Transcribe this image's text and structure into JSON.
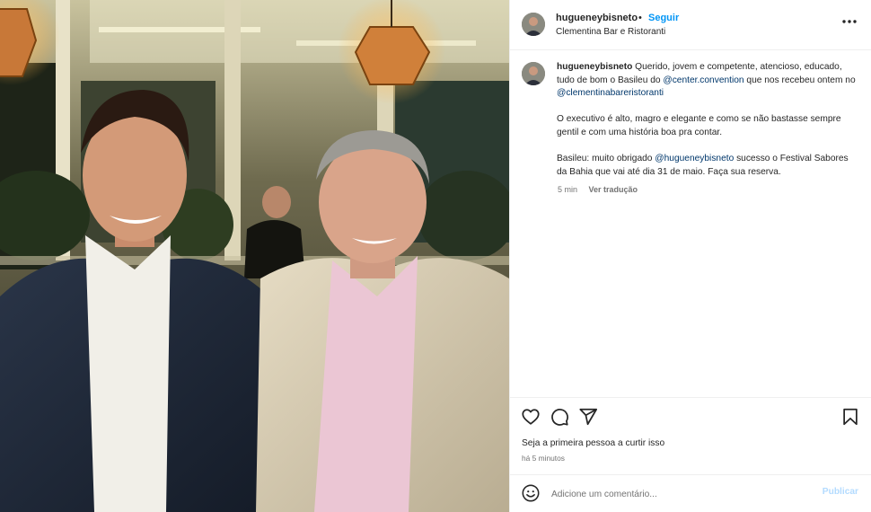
{
  "post": {
    "username": "hugueneybisneto",
    "dot": "•",
    "follow_label": "Seguir",
    "location": "Clementina Bar e Ristoranti",
    "more_icon": "more-horizontal-icon"
  },
  "caption": {
    "username": "hugueneybisneto",
    "p1_a": " Querido, jovem e competente, atencioso, educado, tudo de bom o Basileu do ",
    "mention1": "@center.convention",
    "p1_b": " que nos recebeu ontem no ",
    "mention2": "@clementinabareristoranti",
    "p2": "O executivo é alto, magro e elegante e como se não bastasse sempre gentil e com uma história boa pra contar.",
    "p3_a": "Basileu: muito obrigado ",
    "mention3": "@hugueneybisneto",
    "p3_b": " sucesso o Festival Sabores da Bahia que vai até dia 31 de maio. Faça sua reserva.",
    "age": "5 min",
    "translate_label": "Ver tradução"
  },
  "actions": {
    "like_icon": "heart-icon",
    "comment_icon": "comment-icon",
    "share_icon": "share-icon",
    "save_icon": "bookmark-icon",
    "likes_text": "Seja a primeira pessoa a curtir isso",
    "timestamp": "há 5 minutos"
  },
  "comment": {
    "emoji_icon": "emoji-icon",
    "placeholder": "Adicione um comentário...",
    "publish_label": "Publicar"
  },
  "colors": {
    "accent": "#0095f6",
    "mention": "#00376b",
    "publish_disabled": "#b3dbff",
    "secondary_text": "#737373"
  }
}
